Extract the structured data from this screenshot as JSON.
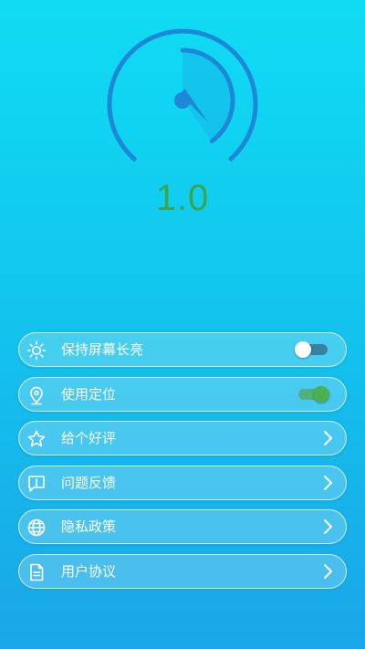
{
  "gauge": {
    "reading": "1.0",
    "ring_color": "#1e88d8",
    "reading_color": "#3aa54b"
  },
  "settings": [
    {
      "label": "保持屏幕长亮",
      "icon": "sun-icon",
      "control": "toggle",
      "on": false
    },
    {
      "label": "使用定位",
      "icon": "location-pin-icon",
      "control": "toggle",
      "on": true
    },
    {
      "label": "给个好评",
      "icon": "star-icon",
      "control": "chevron"
    },
    {
      "label": "问题反馈",
      "icon": "feedback-icon",
      "control": "chevron"
    },
    {
      "label": "隐私政策",
      "icon": "globe-icon",
      "control": "chevron"
    },
    {
      "label": "用户协议",
      "icon": "document-icon",
      "control": "chevron"
    }
  ]
}
